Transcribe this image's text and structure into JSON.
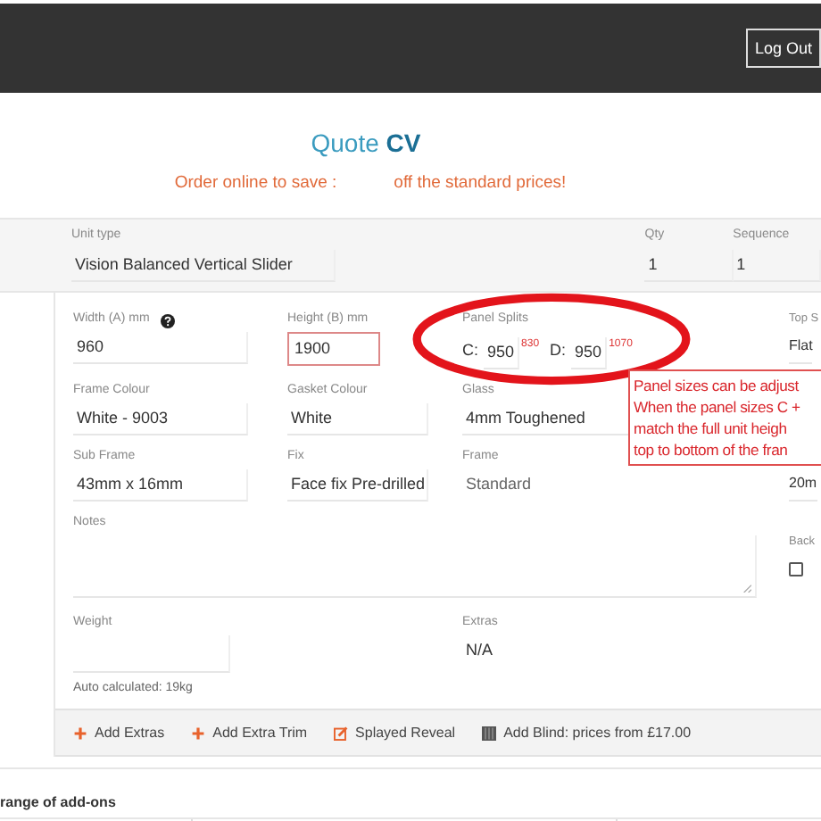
{
  "header": {
    "logout_button": "Log Out"
  },
  "title": {
    "prefix": "Quote",
    "code": "CV"
  },
  "subtitle": {
    "before": "Order online to save :",
    "after": "off the standard prices!"
  },
  "unit_row": [
    {
      "label": "Unit type",
      "value": "Vision Balanced Vertical Slider",
      "kind": "wide"
    },
    {
      "label": "Qty",
      "value": "1",
      "kind": "small"
    },
    {
      "label": "Sequence",
      "value": "1",
      "kind": "small"
    }
  ],
  "form": {
    "width": {
      "label": "Width (A) mm",
      "value": "960"
    },
    "height": {
      "label": "Height (B) mm",
      "value": "1900",
      "highlighted": true
    },
    "panel_splits": {
      "label": "Panel Splits",
      "splits": [
        {
          "letter": "C:",
          "value": "950",
          "note": "830"
        },
        {
          "letter": "D:",
          "value": "950",
          "note": "1070"
        }
      ]
    },
    "top": {
      "label": "Top S",
      "value": "Flat"
    },
    "frame_colour": {
      "label": "Frame Colour",
      "value": "White - 9003"
    },
    "gasket_colour": {
      "label": "Gasket Colour",
      "value": "White"
    },
    "glass": {
      "label": "Glass",
      "value": "4mm Toughened"
    },
    "sub_frame": {
      "label": "Sub Frame",
      "value": "43mm x 16mm"
    },
    "fix": {
      "label": "Fix",
      "value": "Face fix Pre-drilled"
    },
    "frame": {
      "label": "Frame",
      "value": "Standard"
    },
    "col4_row3": {
      "value": "20m"
    },
    "notes": {
      "label": "Notes"
    },
    "back": {
      "label": "Back",
      "checked": false
    },
    "weight": {
      "label": "Weight",
      "hint": "Auto calculated: 19kg"
    },
    "extras": {
      "label": "Extras",
      "value": "N/A"
    }
  },
  "toolbar": [
    {
      "kind": "plus",
      "label": "Add Extras"
    },
    {
      "kind": "plus",
      "label": "Add Extra Trim"
    },
    {
      "kind": "edit",
      "label": "Splayed Reveal"
    },
    {
      "kind": "blind",
      "label": "Add Blind: prices from £17.00"
    }
  ],
  "addons": {
    "heading": "range of add-ons"
  },
  "callout": {
    "lines": [
      "Panel sizes can be adjust",
      "When the panel sizes C +",
      "match the full unit heigh",
      "top to bottom of the fran"
    ]
  }
}
